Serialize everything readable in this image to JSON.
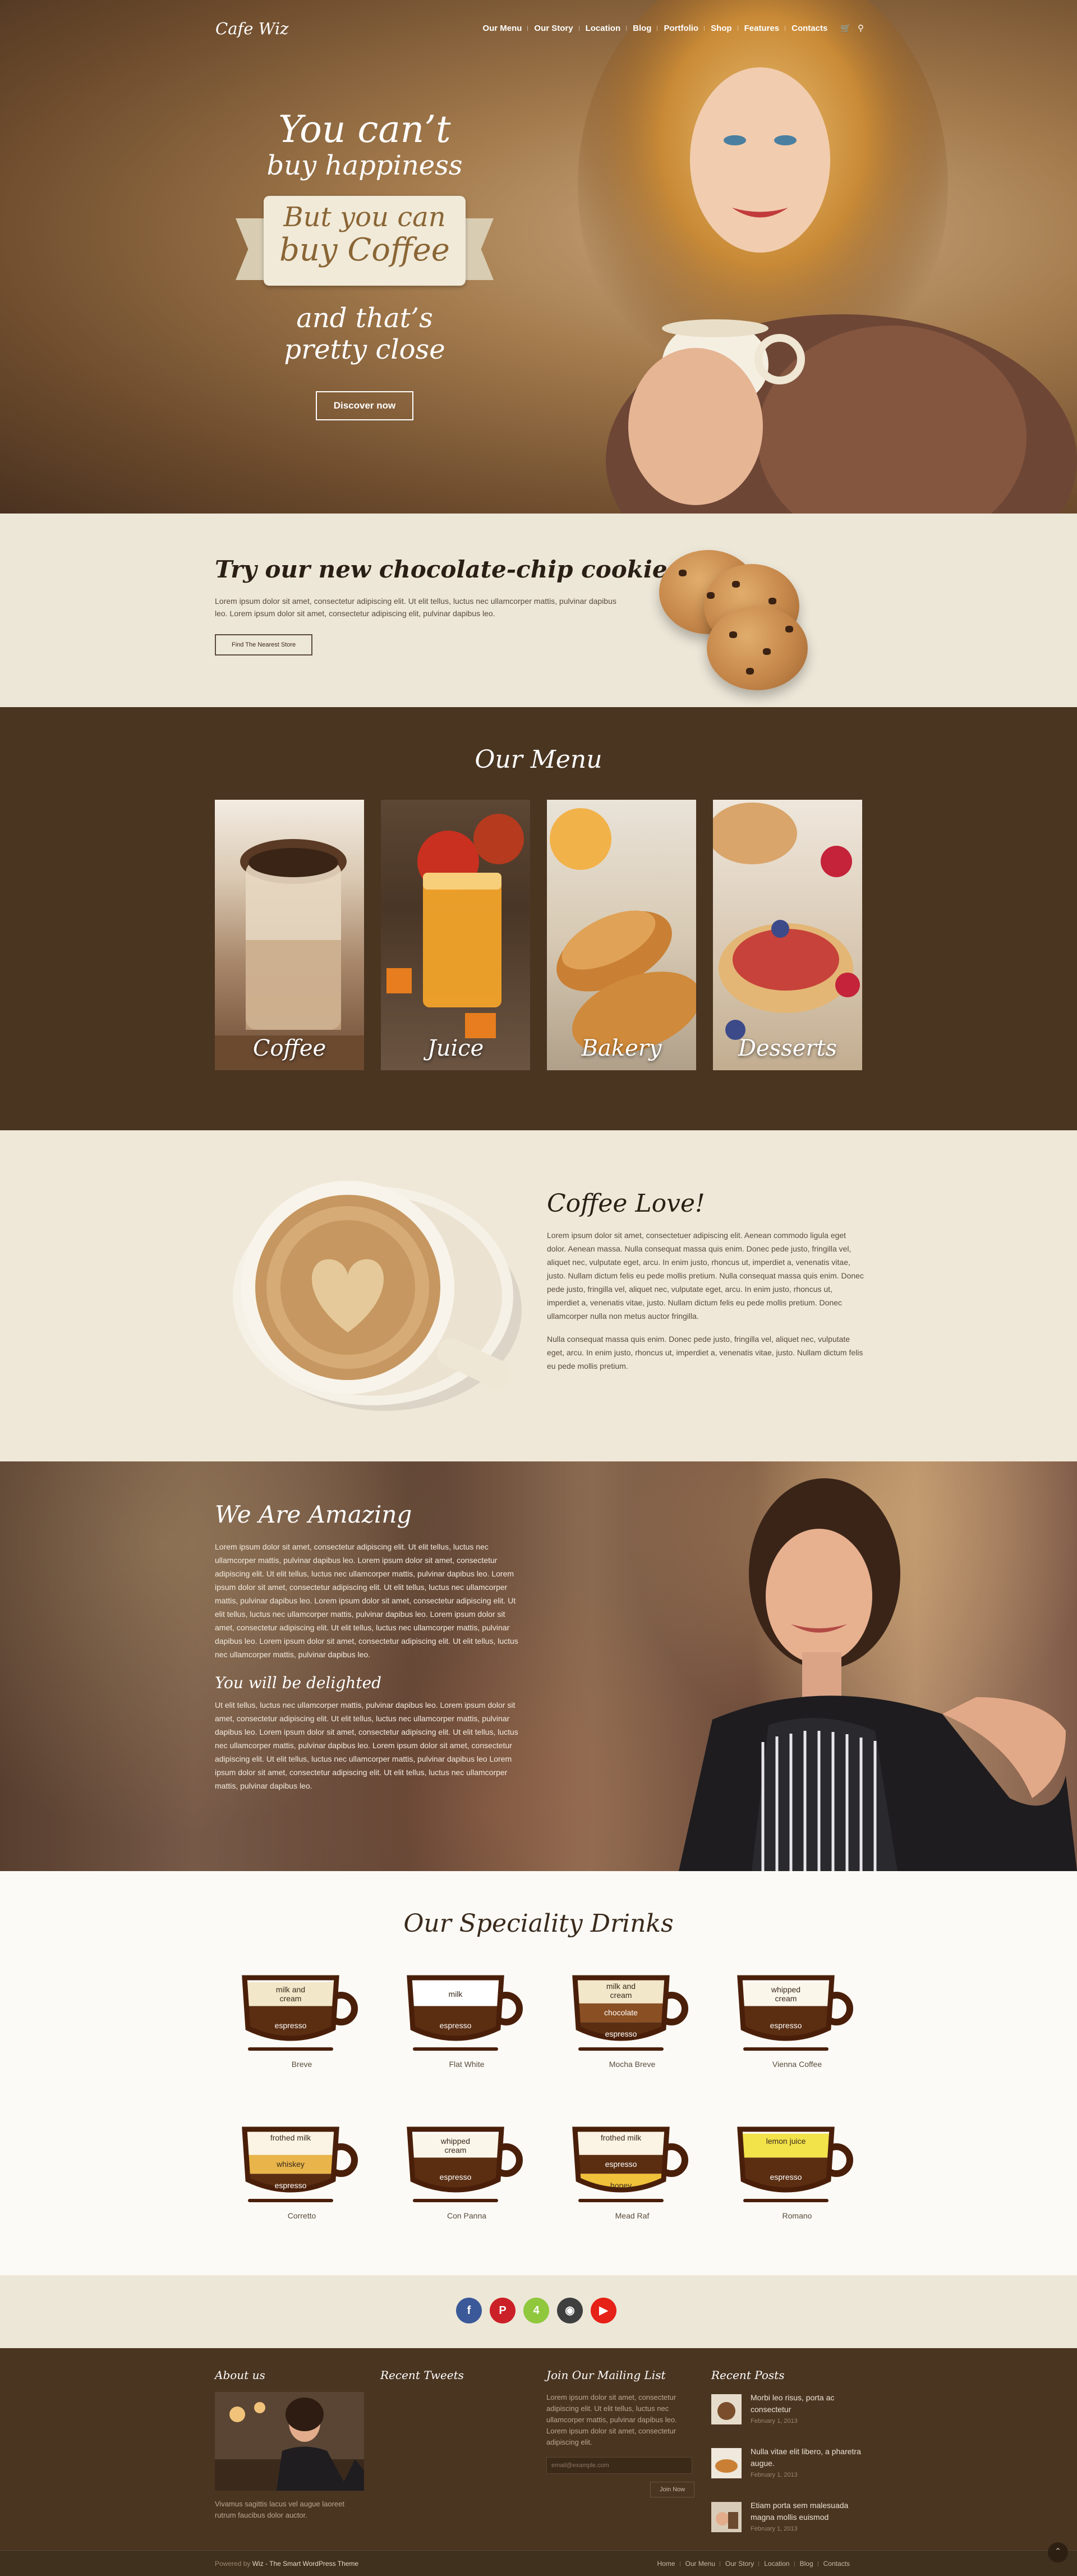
{
  "header": {
    "logo": "Cafe Wiz",
    "nav": [
      "Our Menu",
      "Our Story",
      "Location",
      "Blog",
      "Portfolio",
      "Shop",
      "Features",
      "Contacts"
    ],
    "cart_icon": "cart-icon",
    "search_icon": "search-icon"
  },
  "hero": {
    "line1": "You can’t",
    "line2": "buy happiness",
    "ribbon1": "But you can",
    "ribbon2": "buy Coffee",
    "line3": "and that’s",
    "line4": "pretty close",
    "button": "Discover now"
  },
  "cookies": {
    "title": "Try our new chocolate-chip cookies",
    "body": "Lorem ipsum dolor sit amet, consectetur adipiscing elit. Ut elit tellus, luctus nec ullamcorper mattis, pulvinar dapibus leo. Lorem ipsum dolor sit amet, consectetur adipiscing elit, pulvinar dapibus leo.",
    "button": "Find The Nearest Store"
  },
  "menu": {
    "title": "Our Menu",
    "items": [
      "Coffee",
      "Juice",
      "Bakery",
      "Desserts"
    ]
  },
  "love": {
    "title": "Coffee Love!",
    "p1": "Lorem ipsum dolor sit amet, consectetuer adipiscing elit. Aenean commodo ligula eget dolor. Aenean massa. Nulla consequat massa quis enim. Donec pede justo, fringilla vel, aliquet nec, vulputate eget, arcu. In enim justo, rhoncus ut, imperdiet a, venenatis vitae, justo. Nullam dictum felis eu pede mollis pretium. Nulla consequat massa quis enim. Donec pede justo, fringilla vel, aliquet nec, vulputate eget, arcu. In enim justo, rhoncus ut, imperdiet a, venenatis vitae, justo. Nullam dictum felis eu pede mollis pretium. Donec ullamcorper nulla non metus auctor fringilla.",
    "p2": "Nulla consequat massa quis enim. Donec pede justo, fringilla vel, aliquet nec, vulputate eget, arcu. In enim justo, rhoncus ut, imperdiet a, venenatis vitae, justo. Nullam dictum felis eu pede mollis pretium."
  },
  "amazing": {
    "title": "We Are Amazing",
    "p1": "Lorem ipsum dolor sit amet, consectetur adipiscing elit. Ut elit tellus, luctus nec ullamcorper mattis, pulvinar dapibus leo. Lorem ipsum dolor sit amet, consectetur adipiscing elit. Ut elit tellus, luctus nec ullamcorper mattis, pulvinar dapibus leo. Lorem ipsum dolor sit amet, consectetur adipiscing elit. Ut elit tellus, luctus nec ullamcorper mattis, pulvinar dapibus leo. Lorem ipsum dolor sit amet, consectetur adipiscing elit. Ut elit tellus, luctus nec ullamcorper mattis, pulvinar dapibus leo. Lorem ipsum dolor sit amet, consectetur adipiscing elit. Ut elit tellus, luctus nec ullamcorper mattis, pulvinar dapibus leo. Lorem ipsum dolor sit amet, consectetur adipiscing elit. Ut elit tellus, luctus nec ullamcorper mattis, pulvinar dapibus leo.",
    "subtitle": "You will be delighted",
    "p2": "Ut elit tellus, luctus nec ullamcorper mattis, pulvinar dapibus leo. Lorem ipsum dolor sit amet, consectetur adipiscing elit. Ut elit tellus, luctus nec ullamcorper mattis, pulvinar dapibus leo. Lorem ipsum dolor sit amet, consectetur adipiscing elit. Ut elit tellus, luctus nec ullamcorper mattis, pulvinar dapibus leo. Lorem ipsum dolor sit amet, consectetur adipiscing elit. Ut elit tellus, luctus nec ullamcorper mattis, pulvinar dapibus leo Lorem ipsum dolor sit amet, consectetur adipiscing elit. Ut elit tellus, luctus nec ullamcorper mattis, pulvinar dapibus leo."
  },
  "drinks": {
    "title": "Our Speciality Drinks",
    "items": [
      {
        "name": "Breve",
        "layers": [
          "milk and cream",
          "espresso"
        ]
      },
      {
        "name": "Flat White",
        "layers": [
          "milk",
          "espresso"
        ]
      },
      {
        "name": "Mocha Breve",
        "layers": [
          "milk and cream",
          "chocolate",
          "espresso"
        ]
      },
      {
        "name": "Vienna Coffee",
        "layers": [
          "whipped cream",
          "espresso"
        ]
      },
      {
        "name": "Corretto",
        "layers": [
          "frothed milk",
          "whiskey",
          "espresso"
        ]
      },
      {
        "name": "Con Panna",
        "layers": [
          "whipped cream",
          "espresso"
        ]
      },
      {
        "name": "Mead Raf",
        "layers": [
          "frothed milk",
          "espresso",
          "honey"
        ]
      },
      {
        "name": "Romano",
        "layers": [
          "lemon juice",
          "espresso"
        ]
      }
    ]
  },
  "social": [
    "facebook-icon",
    "pinterest-icon",
    "foursquare-icon",
    "instagram-icon",
    "youtube-icon"
  ],
  "footer": {
    "about_title": "About us",
    "about_text": "Vivamus sagittis lacus vel augue laoreet rutrum faucibus dolor auctor.",
    "tweets_title": "Recent Tweets",
    "mailing_title": "Join Our Mailing List",
    "mailing_text": "Lorem ipsum dolor sit amet, consectetur adipiscing elit. Ut elit tellus, luctus nec ullamcorper mattis, pulvinar dapibus leo. Lorem ipsum dolor sit amet, consectetur adipiscing elit.",
    "email_placeholder": "email@example.com",
    "join_label": "Join Now",
    "posts_title": "Recent Posts",
    "posts": [
      {
        "title": "Morbi leo risus, porta ac consectetur",
        "date": "February 1, 2013"
      },
      {
        "title": "Nulla vitae elit libero, a pharetra augue.",
        "date": "February 1, 2013"
      },
      {
        "title": "Etiam porta sem malesuada magna mollis euismod",
        "date": "February 1, 2013"
      }
    ],
    "powered_prefix": "Powered by ",
    "powered_link": "Wiz - The Smart WordPress Theme",
    "links": [
      "Home",
      "Our Menu",
      "Our Story",
      "Location",
      "Blog",
      "Contacts"
    ]
  },
  "colors": {
    "dark_brown": "#4a3521",
    "cream": "#ede7d8",
    "accent": "#8a6535",
    "facebook": "#3b5998",
    "pinterest": "#cb2027",
    "foursquare": "#8fc83c",
    "instagram": "#3f3f3f",
    "youtube": "#e62117"
  }
}
